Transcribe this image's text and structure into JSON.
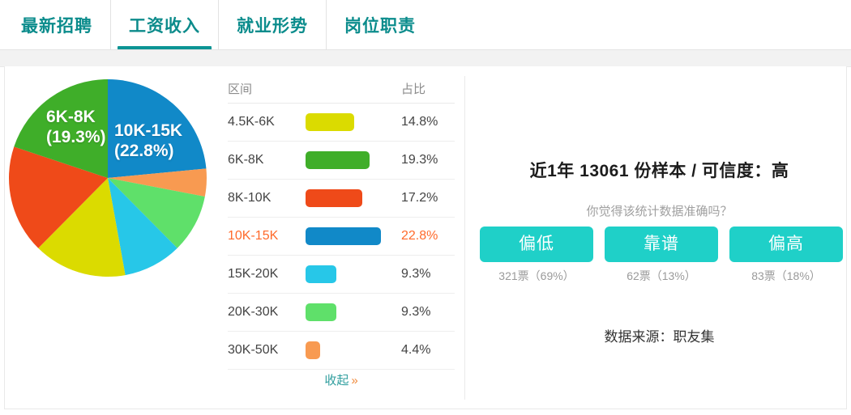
{
  "tabs": [
    {
      "label": "最新招聘",
      "active": false
    },
    {
      "label": "工资收入",
      "active": true
    },
    {
      "label": "就业形势",
      "active": false
    },
    {
      "label": "岗位职责",
      "active": false
    }
  ],
  "table": {
    "header": {
      "range": "区间",
      "percent": "占比"
    },
    "collapse_label": "收起",
    "collapse_arrow": "»"
  },
  "right": {
    "sample_title": "近1年 13061 份样本 / 可信度：高",
    "question": "你觉得该统计数据准确吗？",
    "source": "数据来源：职友集",
    "votes": [
      {
        "label": "偏低",
        "count": "321票（69%）"
      },
      {
        "label": "靠谱",
        "count": "62票（13%）"
      },
      {
        "label": "偏高",
        "count": "83票（18%）"
      }
    ]
  },
  "colors": {
    "accent_teal": "#0b9494",
    "button_teal": "#1fd0c8",
    "highlight_orange": "#ff6a2b"
  },
  "chart_data": {
    "type": "pie",
    "title": "",
    "legend": "table",
    "categories": [
      "4.5K-6K",
      "6K-8K",
      "8K-10K",
      "10K-15K",
      "15K-20K",
      "20K-30K",
      "30K-50K"
    ],
    "values": [
      14.8,
      19.3,
      17.2,
      22.8,
      9.3,
      9.3,
      4.4
    ],
    "value_labels": [
      "14.8%",
      "19.3%",
      "17.2%",
      "22.8%",
      "9.3%",
      "9.3%",
      "4.4%"
    ],
    "colors": [
      "#dbdb00",
      "#3fae29",
      "#ef4a19",
      "#1189c8",
      "#27c7e8",
      "#5fe06a",
      "#f89a51"
    ],
    "highlighted": "10K-15K",
    "slice_labels": [
      {
        "name": "6K-8K",
        "text_line1": "6K-8K",
        "text_line2": "(19.3%)"
      },
      {
        "name": "10K-15K",
        "text_line1": "10K-15K",
        "text_line2": "(22.8%)"
      }
    ],
    "rows": [
      {
        "range": "4.5K-6K",
        "percent": "14.8%",
        "value": 14.8,
        "color": "#dbdb00",
        "highlight": false
      },
      {
        "range": "6K-8K",
        "percent": "19.3%",
        "value": 19.3,
        "color": "#3fae29",
        "highlight": false
      },
      {
        "range": "8K-10K",
        "percent": "17.2%",
        "value": 17.2,
        "color": "#ef4a19",
        "highlight": false
      },
      {
        "range": "10K-15K",
        "percent": "22.8%",
        "value": 22.8,
        "color": "#1189c8",
        "highlight": true
      },
      {
        "range": "15K-20K",
        "percent": "9.3%",
        "value": 9.3,
        "color": "#27c7e8",
        "highlight": false
      },
      {
        "range": "20K-30K",
        "percent": "9.3%",
        "value": 9.3,
        "color": "#5fe06a",
        "highlight": false
      },
      {
        "range": "30K-50K",
        "percent": "4.4%",
        "value": 4.4,
        "color": "#f89a51",
        "highlight": false
      }
    ]
  }
}
